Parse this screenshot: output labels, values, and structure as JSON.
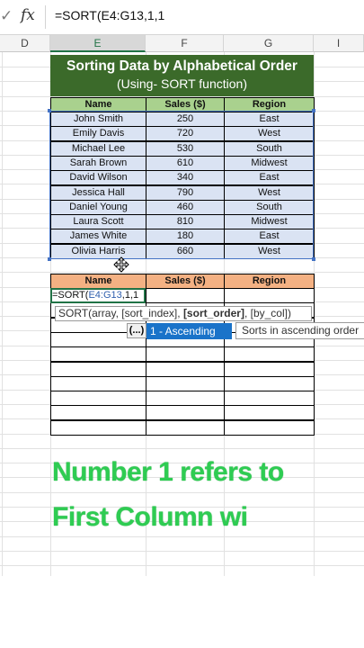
{
  "formula_bar": {
    "check_icon": "check-icon",
    "fx_label": "fx",
    "formula": "=SORT(E4:G13,1,1"
  },
  "columns": [
    "D",
    "E",
    "F",
    "G",
    "I"
  ],
  "title": {
    "line1": "Sorting Data by Alphabetical Order",
    "line2": "(Using- SORT function)"
  },
  "table1": {
    "headers": [
      "Name",
      "Sales ($)",
      "Region"
    ],
    "rows": [
      [
        "John Smith",
        "250",
        "East"
      ],
      [
        "Emily Davis",
        "720",
        "West"
      ],
      [
        "Michael Lee",
        "530",
        "South"
      ],
      [
        "Sarah Brown",
        "610",
        "Midwest"
      ],
      [
        "David Wilson",
        "340",
        "East"
      ],
      [
        "Jessica Hall",
        "790",
        "West"
      ],
      [
        "Daniel Young",
        "460",
        "South"
      ],
      [
        "Laura Scott",
        "810",
        "Midwest"
      ],
      [
        "James White",
        "180",
        "East"
      ],
      [
        "Olivia Harris",
        "660",
        "West"
      ]
    ]
  },
  "table2": {
    "headers": [
      "Name",
      "Sales ($)",
      "Region"
    ]
  },
  "active_cell": {
    "prefix": "=SORT(",
    "ref": "E4:G13",
    "suffix": ",1,1"
  },
  "tooltip": {
    "pre": "SORT(array, [sort_index], ",
    "bold": "[sort_order]",
    "post": ", [by_col])"
  },
  "autocomplete": {
    "button": "(...)",
    "option": "1 - Ascending",
    "description": "Sorts in ascending order"
  },
  "caption": {
    "line1": "Number 1 refers to",
    "line2": "First Column wi"
  },
  "colors": {
    "title_bg": "#3b6a2a",
    "header1_bg": "#a9d18e",
    "header2_bg": "#f4b183",
    "data_bg": "#dae3f3",
    "selection": "#4472c4",
    "caption": "#2ecc52"
  }
}
